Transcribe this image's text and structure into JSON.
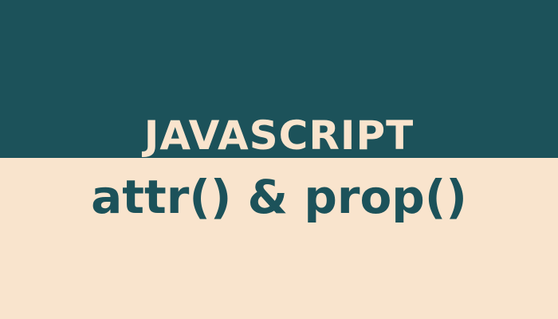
{
  "banner": {
    "line1": "JAVASCRIPT",
    "line2": "attr() & prop()"
  },
  "colors": {
    "dark_teal": "#1C525A",
    "cream": "#F9E4CD"
  }
}
